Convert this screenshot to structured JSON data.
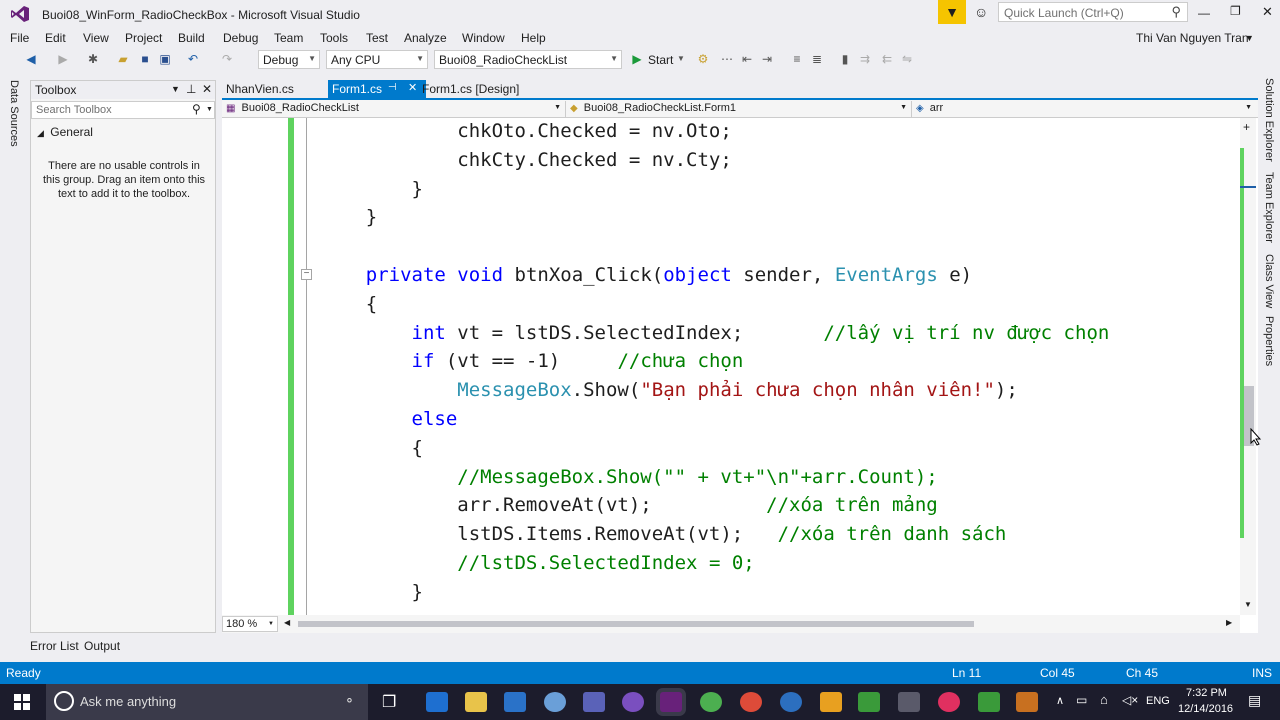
{
  "window": {
    "title": "Buoi08_WinForm_RadioCheckBox - Microsoft Visual Studio",
    "quick_launch_placeholder": "Quick Launch (Ctrl+Q)"
  },
  "menu": [
    "File",
    "Edit",
    "View",
    "Project",
    "Build",
    "Debug",
    "Team",
    "Tools",
    "Test",
    "Analyze",
    "Window",
    "Help"
  ],
  "user": "Thi Van Nguyen Tran",
  "toolbar": {
    "config": "Debug",
    "platform": "Any CPU",
    "startup_project": "Buoi08_RadioCheckList",
    "start_label": "Start"
  },
  "left_strip": {
    "data_sources": "Data Sources"
  },
  "toolbox": {
    "title": "Toolbox",
    "search_placeholder": "Search Toolbox",
    "group": "General",
    "empty_message": "There are no usable controls in this group. Drag an item onto this text to add it to the toolbox."
  },
  "tabs": [
    "NhanVien.cs",
    "Form1.cs",
    "Form1.cs [Design]"
  ],
  "nav": {
    "project": "Buoi08_RadioCheckList",
    "class": "Buoi08_RadioCheckList.Form1",
    "member": "arr"
  },
  "code_lines": [
    {
      "parts": [
        {
          "t": "            chkOto.Checked = nv.Oto;",
          "c": ""
        }
      ]
    },
    {
      "parts": [
        {
          "t": "            chkCty.Checked = nv.Cty;",
          "c": ""
        }
      ]
    },
    {
      "parts": [
        {
          "t": "        }",
          "c": ""
        }
      ]
    },
    {
      "parts": [
        {
          "t": "    }",
          "c": ""
        }
      ]
    },
    {
      "parts": [
        {
          "t": "",
          "c": ""
        }
      ]
    },
    {
      "parts": [
        {
          "t": "    ",
          "c": ""
        },
        {
          "t": "private",
          "c": "kw"
        },
        {
          "t": " ",
          "c": ""
        },
        {
          "t": "void",
          "c": "kw"
        },
        {
          "t": " btnXoa_Click(",
          "c": ""
        },
        {
          "t": "object",
          "c": "kw"
        },
        {
          "t": " sender, ",
          "c": ""
        },
        {
          "t": "EventArgs",
          "c": "ty"
        },
        {
          "t": " e)",
          "c": ""
        }
      ]
    },
    {
      "parts": [
        {
          "t": "    {",
          "c": ""
        }
      ]
    },
    {
      "parts": [
        {
          "t": "        ",
          "c": ""
        },
        {
          "t": "int",
          "c": "kw"
        },
        {
          "t": " vt = lstDS.SelectedIndex;       ",
          "c": ""
        },
        {
          "t": "//lấy vị trí nv được chọn",
          "c": "cm"
        }
      ]
    },
    {
      "parts": [
        {
          "t": "        ",
          "c": ""
        },
        {
          "t": "if",
          "c": "kw"
        },
        {
          "t": " (vt == -1)     ",
          "c": ""
        },
        {
          "t": "//chưa chọn",
          "c": "cm"
        }
      ]
    },
    {
      "parts": [
        {
          "t": "            ",
          "c": ""
        },
        {
          "t": "MessageBox",
          "c": "ty"
        },
        {
          "t": ".Show(",
          "c": ""
        },
        {
          "t": "\"Bạn phải chưa chọn nhân viên!\"",
          "c": "str"
        },
        {
          "t": ");",
          "c": ""
        }
      ]
    },
    {
      "parts": [
        {
          "t": "        ",
          "c": ""
        },
        {
          "t": "else",
          "c": "kw"
        }
      ]
    },
    {
      "parts": [
        {
          "t": "        {",
          "c": ""
        }
      ]
    },
    {
      "parts": [
        {
          "t": "            ",
          "c": ""
        },
        {
          "t": "//MessageBox.Show(\"\" + vt+\"\\n\"+arr.Count);",
          "c": "cm"
        }
      ]
    },
    {
      "parts": [
        {
          "t": "            arr.RemoveAt(vt);          ",
          "c": ""
        },
        {
          "t": "//xóa trên mảng",
          "c": "cm"
        }
      ]
    },
    {
      "parts": [
        {
          "t": "            lstDS.Items.RemoveAt(vt);   ",
          "c": ""
        },
        {
          "t": "//xóa trên danh sách",
          "c": "cm"
        }
      ]
    },
    {
      "parts": [
        {
          "t": "            ",
          "c": ""
        },
        {
          "t": "//lstDS.SelectedIndex = 0;",
          "c": "cm"
        }
      ]
    },
    {
      "parts": [
        {
          "t": "        }",
          "c": ""
        }
      ]
    }
  ],
  "zoom": "180 %",
  "right_strip": [
    "Solution Explorer",
    "Team Explorer",
    "Class View",
    "Properties"
  ],
  "bottom_tabs": [
    "Error List",
    "Output"
  ],
  "status": {
    "state": "Ready",
    "line": "Ln 11",
    "col": "Col 45",
    "ch": "Ch 45",
    "mode": "INS"
  },
  "taskbar": {
    "search_placeholder": "Ask me anything",
    "lang": "ENG",
    "time": "7:32 PM",
    "date": "12/14/2016"
  }
}
